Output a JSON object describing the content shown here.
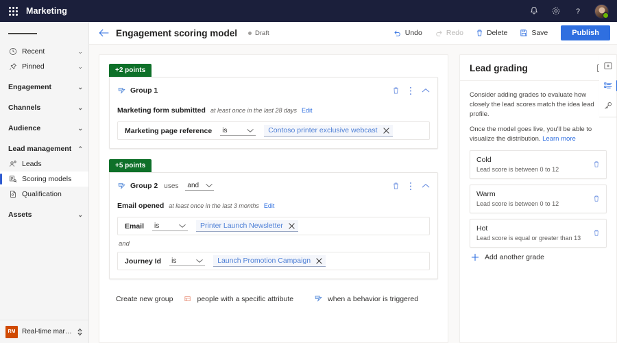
{
  "suite": {
    "waffle_icon": "app-launcher-icon",
    "title": "Marketing",
    "notifications_icon": "bell-icon",
    "settings_icon": "gear-icon",
    "help_icon": "question-mark-icon",
    "avatar_label": "user-avatar"
  },
  "nav": {
    "hamburger_icon": "hamburger-menu-icon",
    "items": [
      {
        "label": "Recent",
        "icon": "clock-icon",
        "type": "leaf-chevron",
        "chevron": "⌄"
      },
      {
        "label": "Pinned",
        "icon": "pin-icon",
        "type": "leaf-chevron",
        "chevron": "⌄"
      },
      {
        "label": "Engagement",
        "icon": "",
        "type": "group",
        "chevron": "⌄"
      },
      {
        "label": "Channels",
        "icon": "",
        "type": "group",
        "chevron": "⌄"
      },
      {
        "label": "Audience",
        "icon": "",
        "type": "group",
        "chevron": "⌄"
      },
      {
        "label": "Lead management",
        "icon": "",
        "type": "group",
        "chevron": "⌃"
      },
      {
        "label": "Leads",
        "icon": "leads-icon",
        "type": "leaf"
      },
      {
        "label": "Scoring models",
        "icon": "scoring-models-icon",
        "type": "leaf",
        "selected": true
      },
      {
        "label": "Qualification",
        "icon": "qualification-icon",
        "type": "leaf"
      },
      {
        "label": "Assets",
        "icon": "",
        "type": "group",
        "chevron": "⌄"
      }
    ],
    "area_switcher": {
      "badge": "RM",
      "label": "Real-time marketi...",
      "icon": "up-down-chevron-icon"
    }
  },
  "command_bar": {
    "back_icon": "back-arrow-icon",
    "title": "Engagement scoring model",
    "status": "Draft",
    "undo": {
      "label": "Undo",
      "icon": "undo-icon",
      "disabled": false
    },
    "redo": {
      "label": "Redo",
      "icon": "redo-icon",
      "disabled": true
    },
    "delete": {
      "label": "Delete",
      "icon": "trash-icon",
      "disabled": false
    },
    "save": {
      "label": "Save",
      "icon": "save-icon",
      "disabled": false
    },
    "publish": {
      "label": "Publish"
    }
  },
  "builder": {
    "groups": [
      {
        "points": "+2 points",
        "icon": "behavior-trigger-icon",
        "name": "Group 1",
        "uses_label": "",
        "logic_operator": "",
        "actions": {
          "delete_icon": "trash-icon",
          "more_icon": "more-vertical-icon",
          "collapse_icon": "chevron-up-icon"
        },
        "trigger": {
          "name": "Marketing form submitted",
          "meta": "at least once in the last 28 days",
          "edit": "Edit"
        },
        "conditions": [
          {
            "attribute": "Marketing page reference",
            "operator": "is",
            "value": "Contoso printer exclusive webcast",
            "remove_icon": "close-icon"
          }
        ],
        "separators": []
      },
      {
        "points": "+5 points",
        "icon": "behavior-trigger-icon",
        "name": "Group 2",
        "uses_label": "uses",
        "logic_operator": "and",
        "actions": {
          "delete_icon": "trash-icon",
          "more_icon": "more-vertical-icon",
          "collapse_icon": "chevron-up-icon"
        },
        "trigger": {
          "name": "Email opened",
          "meta": "at least once in the last 3 months",
          "edit": "Edit"
        },
        "conditions": [
          {
            "attribute": "Email",
            "operator": "is",
            "value": "Printer Launch Newsletter",
            "remove_icon": "close-icon"
          },
          {
            "attribute": "Journey Id",
            "operator": "is",
            "value": "Launch Promotion Campaign",
            "remove_icon": "close-icon"
          }
        ],
        "separators": [
          "and"
        ]
      }
    ],
    "create_new_group": {
      "label": "Create new group",
      "options": [
        {
          "label": "people with a specific attribute",
          "icon": "attribute-group-icon"
        },
        {
          "label": "when a behavior is triggered",
          "icon": "behavior-trigger-icon"
        }
      ]
    }
  },
  "right_panel": {
    "title": "Lead grading",
    "collapse_icon": "panel-collapse-icon",
    "intro_1": "Consider adding grades to evaluate how closely the lead scores match the idea lead profile.",
    "intro_2": "Once the model goes live, you'll be able to visualize the distribution.",
    "learn_more": "Learn more",
    "grades": [
      {
        "name": "Cold",
        "description": "Lead score is between 0 to 12",
        "delete_icon": "trash-icon"
      },
      {
        "name": "Warm",
        "description": "Lead score is between 0 to 12",
        "delete_icon": "trash-icon"
      },
      {
        "name": "Hot",
        "description": "Lead score is equal or greater than 13",
        "delete_icon": "trash-icon"
      }
    ],
    "add_grade": {
      "label": "Add another grade",
      "icon": "plus-icon"
    },
    "rail": [
      {
        "icon": "add-panel-icon",
        "active": false
      },
      {
        "icon": "list-properties-icon",
        "active": true
      },
      {
        "icon": "key-icon",
        "active": false
      }
    ]
  },
  "colors": {
    "suitebar": "#1b1f3b",
    "accent": "#2f6fe0",
    "points_green": "#0e7029",
    "canvas": "#faf9f8",
    "nav": "#f5f5f5",
    "area_badge": "#d04a02"
  }
}
